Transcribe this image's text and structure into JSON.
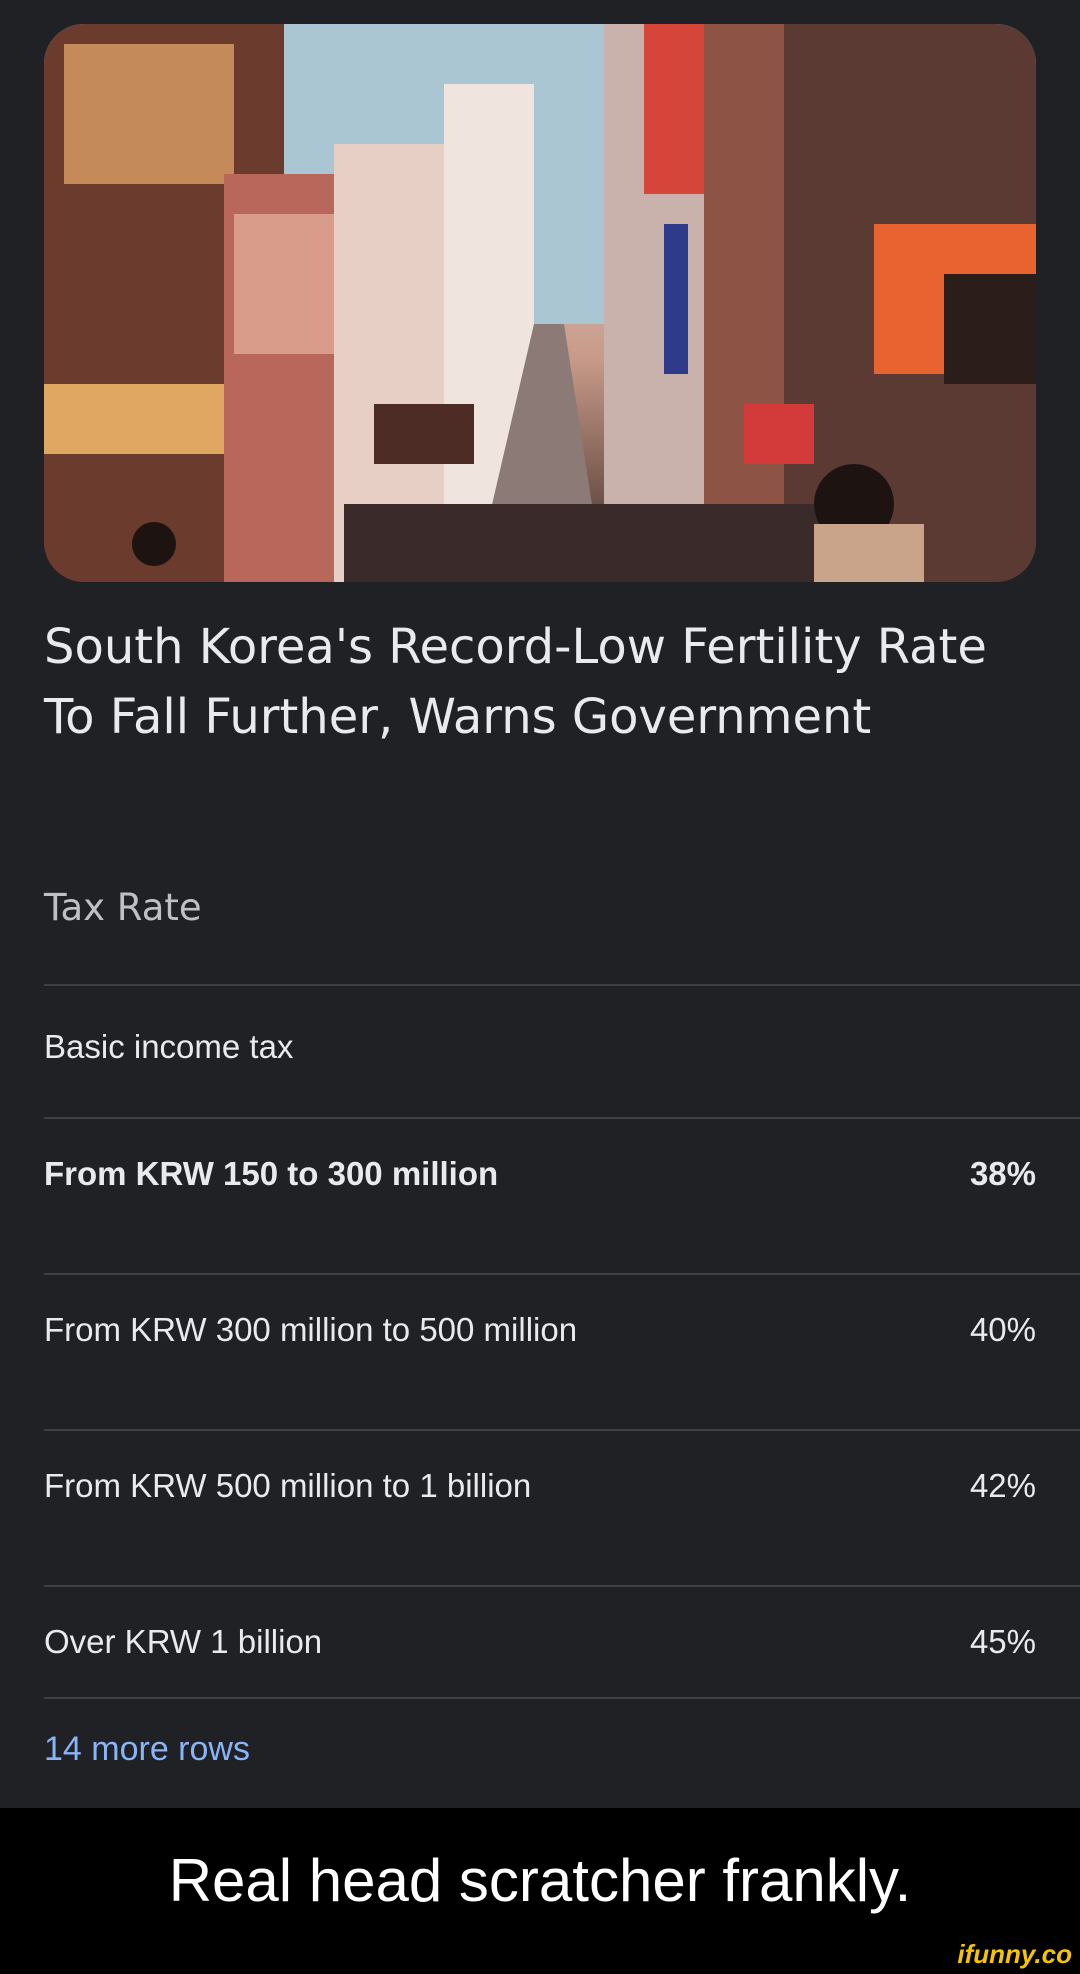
{
  "article": {
    "image_alt_icon": "street-photo",
    "headline": "South Korea's Record-Low Fertility Rate To Fall Further, Warns Government"
  },
  "tax_table": {
    "header": "Tax Rate",
    "section": "Basic income tax",
    "rows": [
      {
        "label": "From KRW 150 to 300 million",
        "value": "38%"
      },
      {
        "label": "From KRW 300 million to 500 million",
        "value": "40%"
      },
      {
        "label": "From KRW 500 million to 1 billion",
        "value": "42%"
      },
      {
        "label": "Over KRW 1 billion",
        "value": "45%"
      }
    ],
    "more_rows": "14 more rows"
  },
  "caption": "Real head scratcher frankly.",
  "watermark": "ifunny.co",
  "colors": {
    "background": "#202124",
    "link": "#8ab4f8",
    "caption_bg": "#000000",
    "watermark": "#f5c400"
  }
}
